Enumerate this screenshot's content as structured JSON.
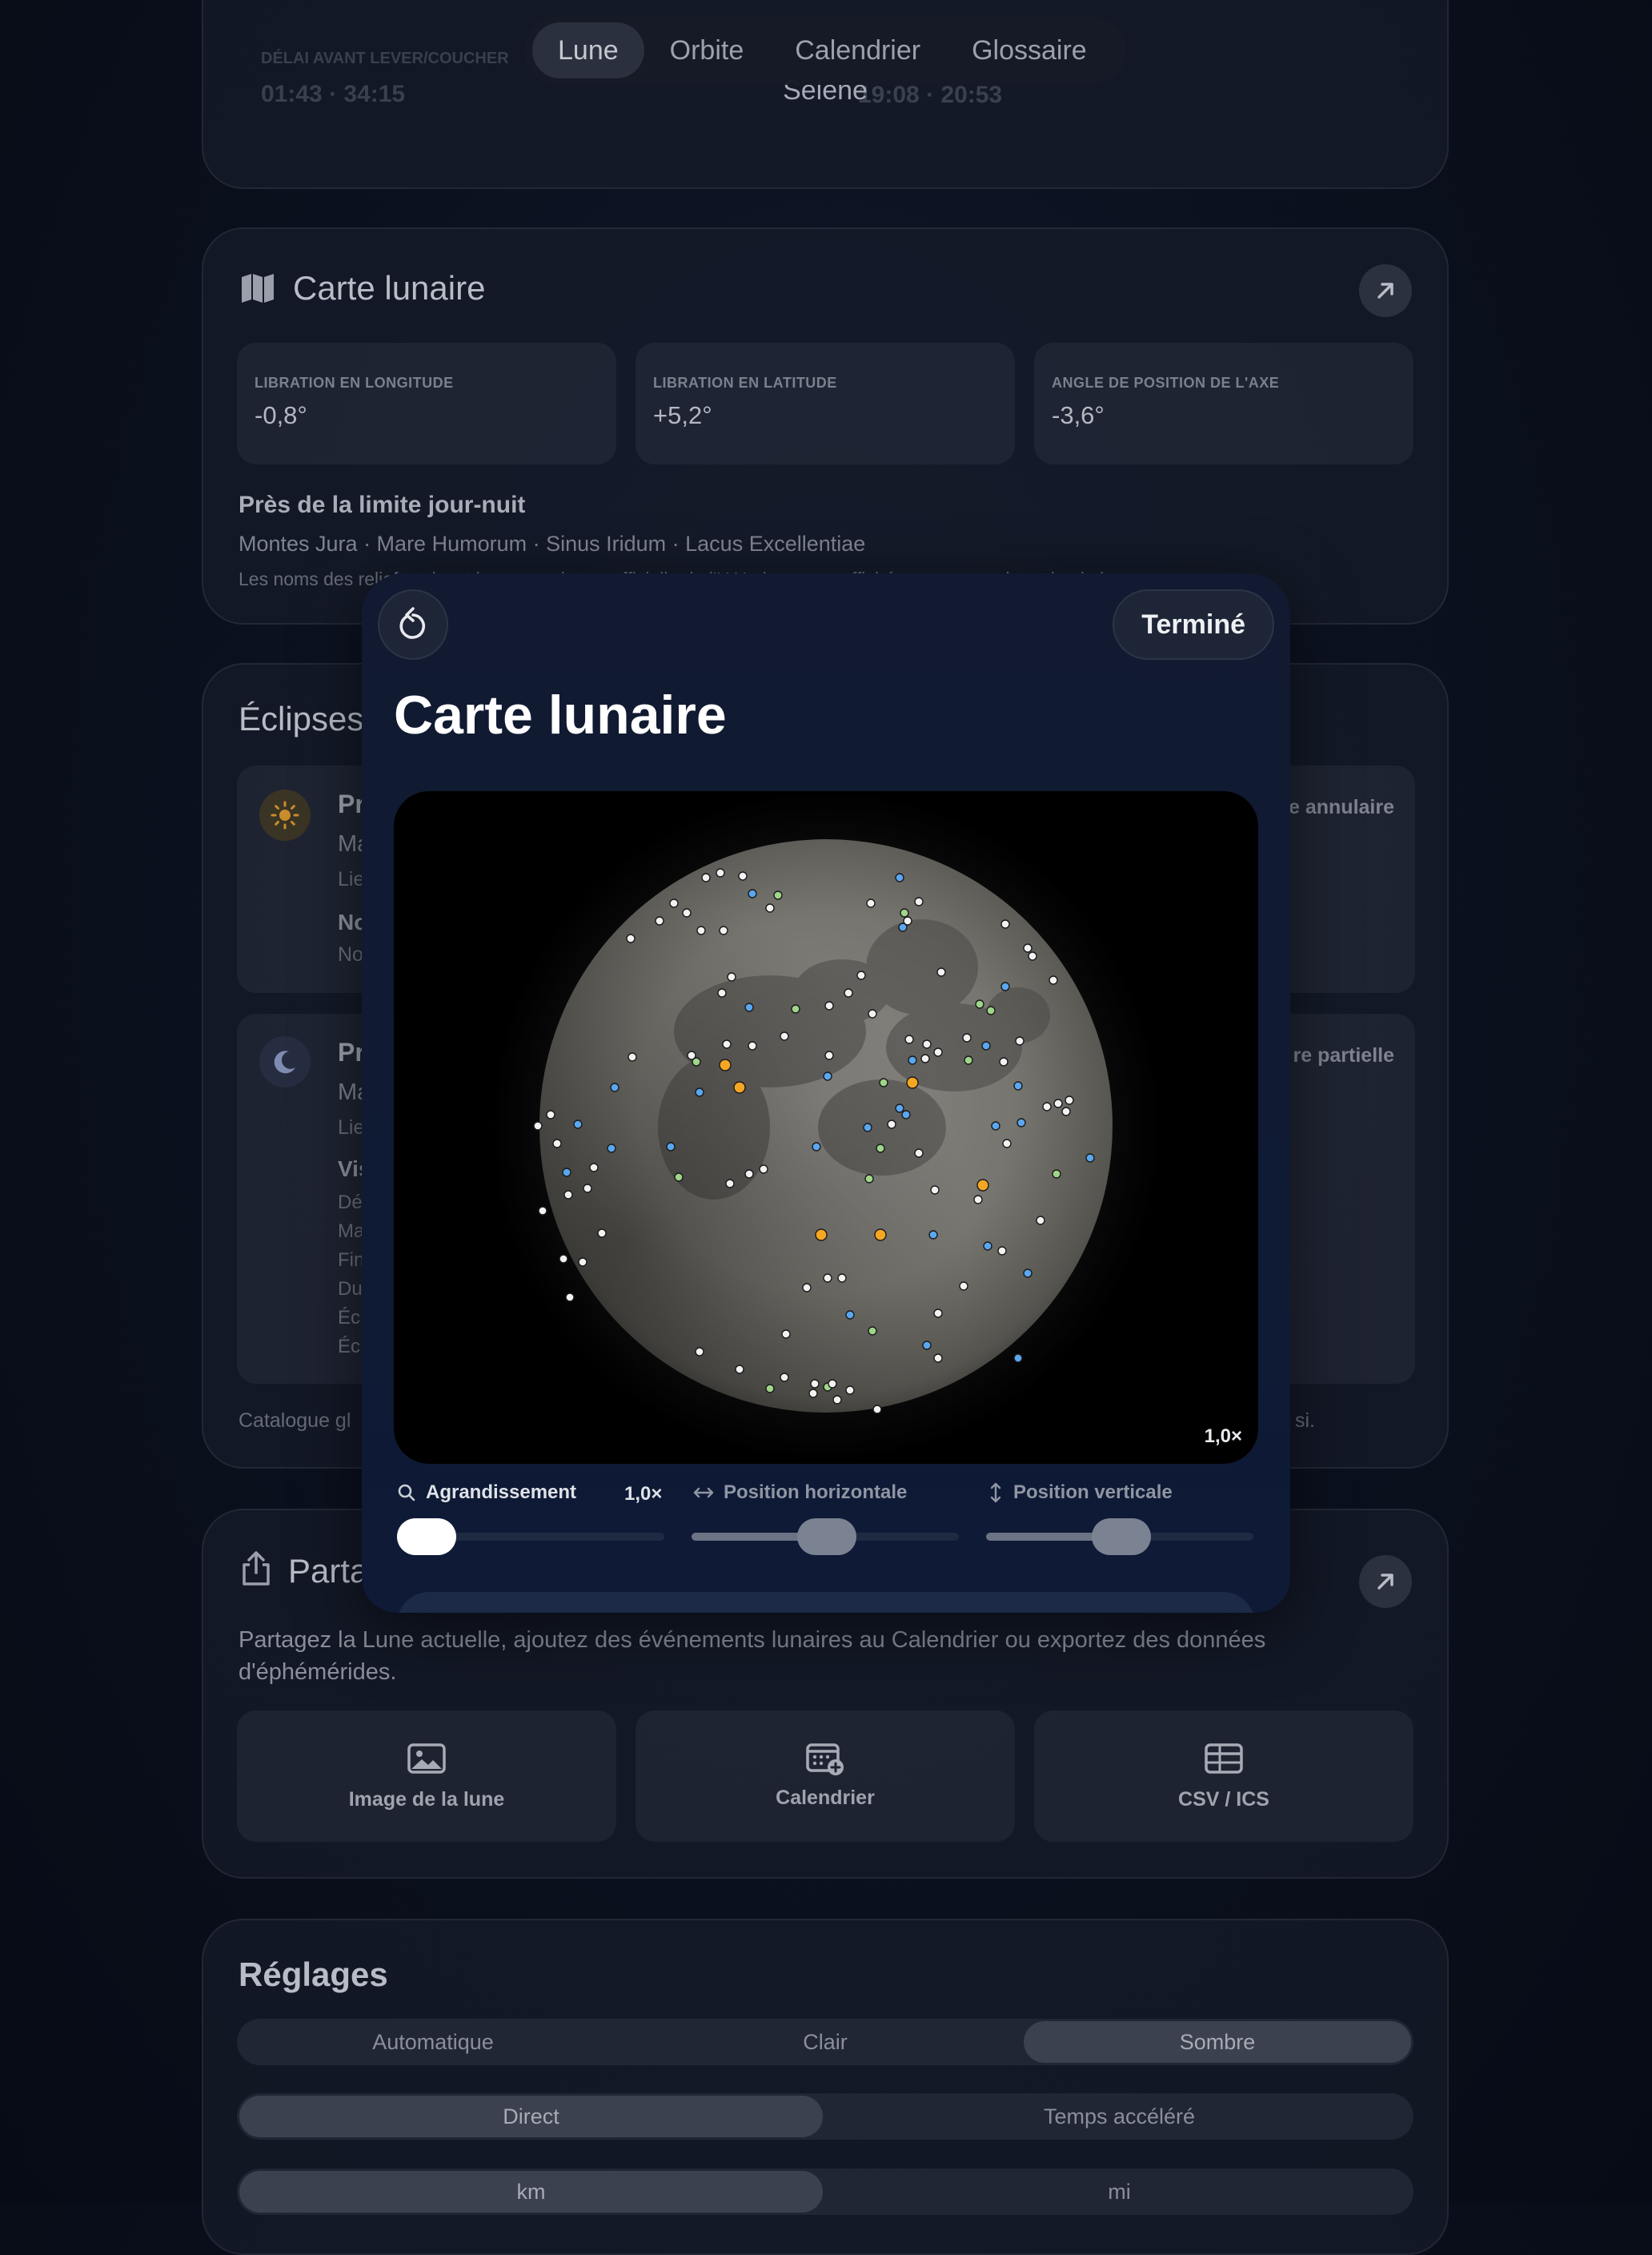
{
  "top_card": {
    "left_label": "DÉLAI AVANT LEVER/COUCHER",
    "left_value": "01:43 · 34:15",
    "right_value": "19:08 · 20:53",
    "center_label": "Selene"
  },
  "tabs": [
    {
      "label": "Lune",
      "selected": true
    },
    {
      "label": "Orbite",
      "selected": false
    },
    {
      "label": "Calendrier",
      "selected": false
    },
    {
      "label": "Glossaire",
      "selected": false
    }
  ],
  "map_card": {
    "title": "Carte lunaire",
    "stats": [
      {
        "label": "LIBRATION EN LONGITUDE",
        "value": "-0,8°"
      },
      {
        "label": "LIBRATION EN LATITUDE",
        "value": "+5,2°"
      },
      {
        "label": "ANGLE DE POSITION DE L'AXE",
        "value": "-3,6°"
      }
    ],
    "terminator_title": "Près de la limite jour-nuit",
    "features": "Montes Jura · Mare Humorum · Sinus Iridum · Lacus Excellentiae",
    "note": "Les noms des reliefs suivent la nomenclature officielle de l'UAI ; les noms affichés peuvent varier selon la langue."
  },
  "eclipses_card": {
    "title": "Éclipses",
    "solar": {
      "title": "Pr",
      "right_tag": "e annulaire",
      "line1": "Ma",
      "line2": "Lie",
      "sub_title": "No",
      "sub_line": "No"
    },
    "lunar": {
      "title": "Pr",
      "right_tag": "re partielle",
      "line1": "Ma",
      "line2": "Lie",
      "sub_title": "Vis",
      "rows": [
        "Dé",
        "Ma",
        "Fin",
        "Du",
        "Éc",
        "Éc"
      ]
    },
    "footer_left": "Catalogue gl",
    "footer_right": "si."
  },
  "share_card": {
    "title": "Parta",
    "description": "Partagez la Lune actuelle, ajoutez des événements lunaires au Calendrier ou exportez des données d'éphémérides.",
    "buttons": [
      {
        "label": "Image de la lune",
        "icon": "photo-icon"
      },
      {
        "label": "Calendrier",
        "icon": "calendar-add-icon"
      },
      {
        "label": "CSV / ICS",
        "icon": "table-icon"
      }
    ]
  },
  "settings_card": {
    "title": "Réglages",
    "theme": {
      "options": [
        "Automatique",
        "Clair",
        "Sombre"
      ],
      "selected": "Sombre"
    },
    "mode": {
      "options": [
        "Direct",
        "Temps accéléré"
      ],
      "selected": "Direct"
    },
    "units": {
      "options": [
        "km",
        "mi"
      ],
      "selected": "km"
    }
  },
  "modal": {
    "title": "Carte lunaire",
    "done_label": "Terminé",
    "reset_icon": "reset-icon",
    "zoom_badge": "1,0×",
    "controls": {
      "zoom": {
        "label": "Agrandissement",
        "value_text": "1,0×",
        "level": 0.0
      },
      "horizontal": {
        "label": "Position horizontale",
        "level": 0.5
      },
      "vertical": {
        "label": "Position verticale",
        "level": 0.5
      }
    },
    "markers": {
      "colors": {
        "white": "#f2f2f2",
        "blue": "#5aa7f0",
        "green": "#9fd68a",
        "orange": "#f5a623"
      }
    }
  }
}
